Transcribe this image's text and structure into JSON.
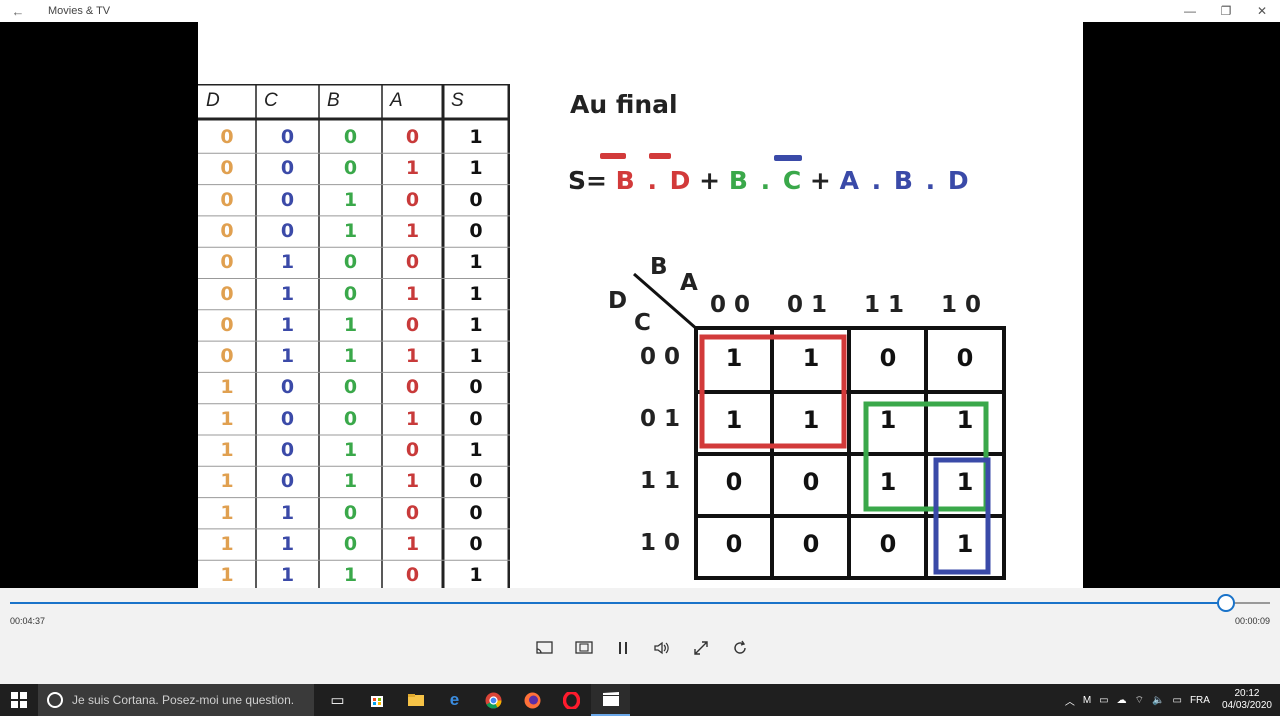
{
  "window": {
    "title": "Movies & TV",
    "back_icon": "back-arrow-icon",
    "minimize_icon": "minimize-icon",
    "restore_icon": "restore-icon",
    "close_icon": "close-icon"
  },
  "slide": {
    "truth_table": {
      "headers": [
        "D",
        "C",
        "B",
        "A",
        "S"
      ],
      "rows": [
        [
          0,
          0,
          0,
          0,
          1
        ],
        [
          0,
          0,
          0,
          1,
          1
        ],
        [
          0,
          0,
          1,
          0,
          0
        ],
        [
          0,
          0,
          1,
          1,
          0
        ],
        [
          0,
          1,
          0,
          0,
          1
        ],
        [
          0,
          1,
          0,
          1,
          1
        ],
        [
          0,
          1,
          1,
          0,
          1
        ],
        [
          0,
          1,
          1,
          1,
          1
        ],
        [
          1,
          0,
          0,
          0,
          0
        ],
        [
          1,
          0,
          0,
          1,
          0
        ],
        [
          1,
          0,
          1,
          0,
          1
        ],
        [
          1,
          0,
          1,
          1,
          0
        ],
        [
          1,
          1,
          0,
          0,
          0
        ],
        [
          1,
          1,
          0,
          1,
          0
        ],
        [
          1,
          1,
          1,
          0,
          1
        ]
      ],
      "column_colors": [
        "#e0a050",
        "#3b4aa8",
        "#3aa84a",
        "#c83a3a",
        "#111111"
      ]
    },
    "heading": "Au final",
    "formula": {
      "prefix": "S=",
      "term1": {
        "b": "B",
        "dot": ".",
        "d": "D",
        "color": "#d23a3a"
      },
      "plus1": "+",
      "term2": {
        "b": "B",
        "dot": ".",
        "c": "C",
        "color": "#3aa84a"
      },
      "plus2": "+",
      "term3": {
        "a": "A",
        "dot1": ".",
        "b": "B",
        "dot2": ".",
        "d": "D",
        "color": "#3a4aa8"
      }
    },
    "kmap": {
      "label_b": "B",
      "label_a": "A",
      "label_d": "D",
      "label_c": "C",
      "col_headers": [
        "0 0",
        "0 1",
        "1 1",
        "1 0"
      ],
      "row_headers": [
        "0 0",
        "0 1",
        "1 1",
        "1 0"
      ],
      "cells": [
        [
          "1",
          "1",
          "0",
          "0"
        ],
        [
          "1",
          "1",
          "1",
          "1"
        ],
        [
          "0",
          "0",
          "1",
          "1"
        ],
        [
          "0",
          "0",
          "0",
          "1"
        ]
      ],
      "group_colors": [
        "#d23a3a",
        "#3aa84a",
        "#3a4aa8"
      ]
    }
  },
  "player": {
    "elapsed": "00:04:37",
    "remaining": "00:00:09",
    "progress": 0.965,
    "controls": [
      "cast-icon",
      "aspect-icon",
      "pause-icon",
      "volume-icon",
      "fullscreen-icon",
      "repeat-icon"
    ]
  },
  "taskbar": {
    "search_placeholder": "Je suis Cortana. Posez-moi une question.",
    "language": "FRA",
    "time": "20:12",
    "date": "04/03/2020"
  }
}
